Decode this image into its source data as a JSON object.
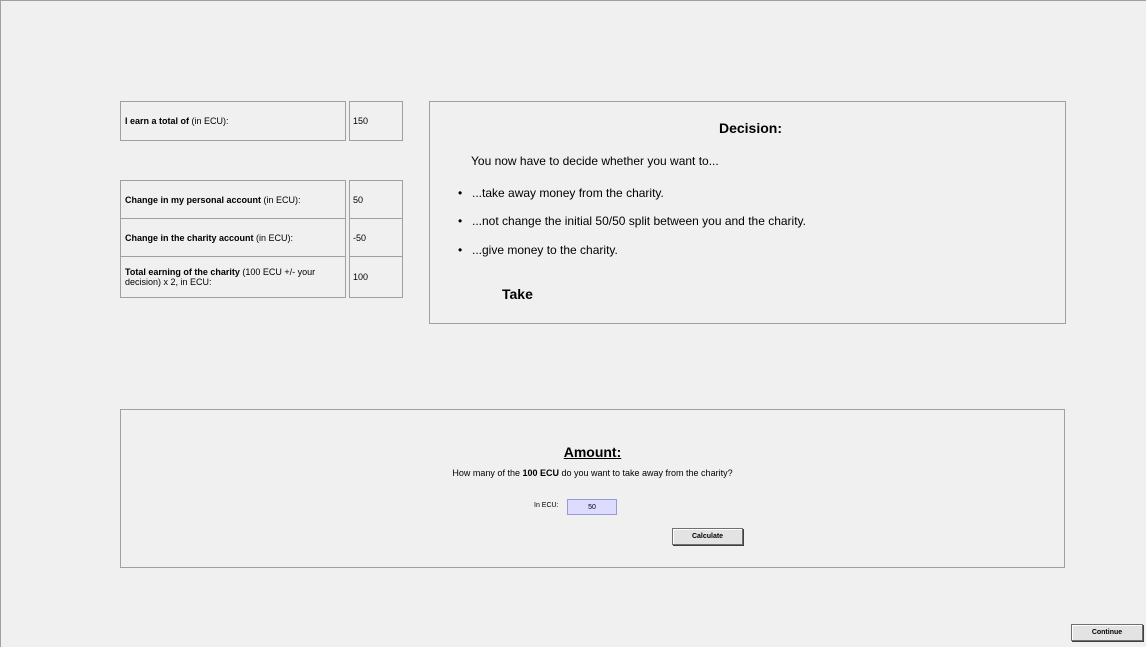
{
  "summary": {
    "rows": [
      {
        "label_bold": "I earn a total of",
        "label_rest": " (in ECU):",
        "value": "150"
      },
      {
        "label_bold": "Change in my personal account",
        "label_rest": " (in ECU):",
        "value": "50"
      },
      {
        "label_bold": "Change in the charity account",
        "label_rest": " (in ECU):",
        "value": "-50"
      },
      {
        "label_bold": "Total earning of the charity",
        "label_rest": " (100 ECU +/- your decision) x 2, in ECU:",
        "value": "100"
      }
    ]
  },
  "decision": {
    "title": "Decision:",
    "intro": "You now have to decide whether you want to...",
    "options": [
      "...take away money from the charity.",
      "...not change the initial 50/50 split between you and the charity.",
      "...give money to the charity."
    ],
    "bullet": "•",
    "choice": "Take"
  },
  "amount": {
    "title": "Amount:",
    "question_pre": "How many of the ",
    "question_bold": "100 ECU",
    "question_post": " do you want to take away from the charity?",
    "ecu_label": "In ECU:",
    "ecu_value": "50",
    "calculate_label": "Calculate"
  },
  "footer": {
    "continue_label": "Continue"
  }
}
